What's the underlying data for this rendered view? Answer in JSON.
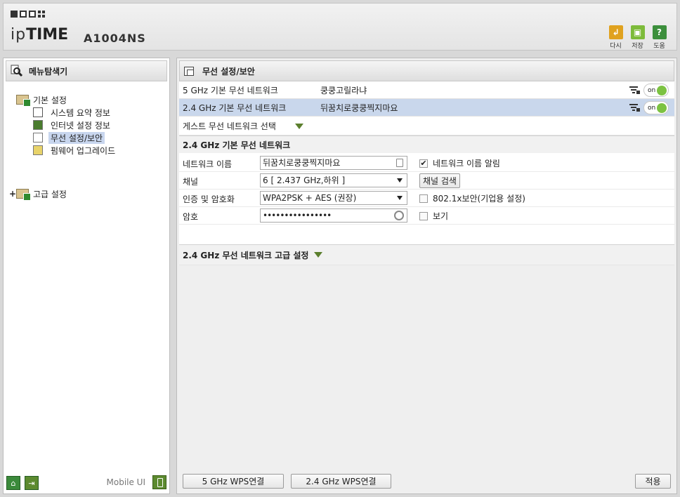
{
  "header": {
    "brand_ip": "ip",
    "brand_time": "TIME",
    "model": "A1004NS",
    "buttons": [
      {
        "label": "다시",
        "icon": "back-icon",
        "color": "#e0a21f"
      },
      {
        "label": "저장",
        "icon": "save-icon",
        "color": "#7dbb3a"
      },
      {
        "label": "도움",
        "icon": "help-icon",
        "color": "#3c8f3c"
      }
    ]
  },
  "sidebar": {
    "title": "메뉴탐색기",
    "groups": [
      {
        "label": "기본 설정",
        "items": [
          {
            "label": "시스템 요약 정보"
          },
          {
            "label": "인터넷 설정 정보"
          },
          {
            "label": "무선 설정/보안"
          },
          {
            "label": "펌웨어 업그레이드"
          }
        ]
      },
      {
        "label": "고급 설정",
        "expander": "+"
      }
    ],
    "footer": {
      "mobile_ui": "Mobile UI"
    }
  },
  "main": {
    "title": "무선 설정/보안",
    "networks": [
      {
        "name": "5 GHz 기본 무선 네트워크",
        "ssid": "쿵쿵고릴라냐",
        "toggle": "on"
      },
      {
        "name": "2.4 GHz 기본 무선 네트워크",
        "ssid": "뒤꿈치로쿵쿵찍지마요",
        "toggle": "on"
      }
    ],
    "guest_label": "게스트 무선 네트워크 선택",
    "section_title": "2.4 GHz 기본 무선 네트워크",
    "form": {
      "network_name_label": "네트워크 이름",
      "network_name_value": "뒤꿈치로쿵쿵찍지마요",
      "broadcast_label": "네트워크 이름 알림",
      "broadcast_checked": "✔",
      "channel_label": "채널",
      "channel_value": "6 [ 2.437 GHz,하위 ]",
      "channel_scan": "채널 검색",
      "auth_label": "인증 및 암호화",
      "auth_value": "WPA2PSK + AES (권장)",
      "enterprise_label": "802.1x보안(기업용 설정)",
      "password_label": "암호",
      "password_value": "••••••••••••••••",
      "show_label": "보기"
    },
    "advanced_title": "2.4 GHz 무선 네트워크 고급 설정",
    "bottom": {
      "wps5": "5 GHz WPS연결",
      "wps24": "2.4 GHz WPS연결",
      "apply": "적용"
    }
  }
}
